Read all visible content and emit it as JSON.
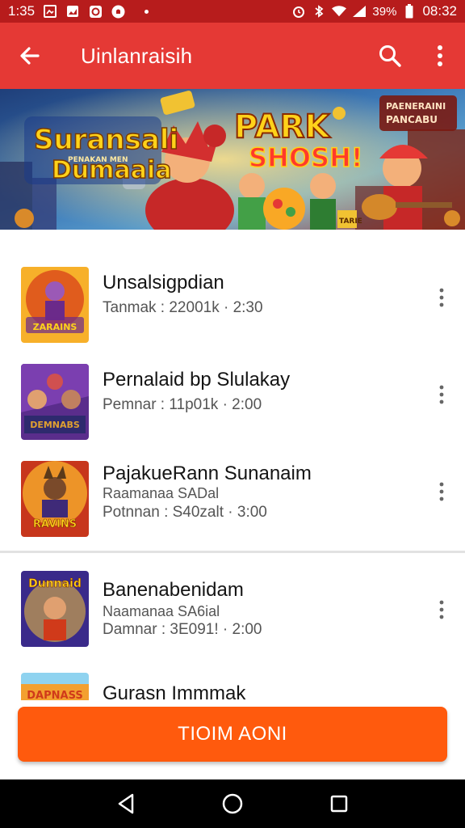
{
  "status_bar": {
    "time": "1:35",
    "battery": "39%",
    "clock": "08:32",
    "icons": [
      "gallery-icon",
      "image-icon",
      "camera-icon",
      "notification-icon",
      "alarm-icon",
      "bluetooth-icon",
      "wifi-icon",
      "signal-icon"
    ]
  },
  "app_bar": {
    "title": "Uinlanraisih",
    "icons": [
      "back-arrow-icon",
      "search-icon",
      "more-vert-icon"
    ]
  },
  "banner": {
    "title_line1": "Suransali",
    "title_sub": "PENAKAN MEN",
    "title_line2": "Dumaaia",
    "park_text": "PARK",
    "shosh_text": "SHOSH!",
    "corner_line1": "PAENERAINI",
    "corner_line2": "PANCABU",
    "badge_text": "TARIE"
  },
  "list": {
    "items": [
      {
        "title": "Unsalsigpdian",
        "line1": "",
        "line2": "Tanmak : 22001k · 2:30",
        "thumb_label": "ZARAINS",
        "colors": [
          "#f7b02a",
          "#d9471a",
          "#6b2a8a"
        ]
      },
      {
        "title": "Pernalaid bp Slulakay",
        "line1": "",
        "line2": "Pemnar : 11p01k · 2:00",
        "thumb_label": "DEMNABS",
        "colors": [
          "#5a2d8c",
          "#2e2a6e",
          "#e0a030"
        ]
      },
      {
        "title": "PajakueRann Sunanaim",
        "line1": "Raamanaa SADal",
        "line2": "Potnnan : S40zalt · 3:00",
        "thumb_label": "RAVINS",
        "colors": [
          "#f3a52a",
          "#c7361c",
          "#3f2a78"
        ]
      },
      {
        "title": "Banenabenidam",
        "line1": "Naamanaa SA6ial",
        "line2": "Damnar : 3E091! · 2:00",
        "thumb_label": "Dunnaid",
        "colors": [
          "#f2c23a",
          "#3a2a8a",
          "#d03a1a"
        ]
      },
      {
        "title": "Gurasn Immmak",
        "line1": "",
        "line2": "",
        "thumb_label": "DAPNASS",
        "colors": [
          "#8fd3f0",
          "#f3a030",
          "#d03a1a"
        ]
      }
    ]
  },
  "cta": {
    "label": "TIOIM AONI"
  },
  "nav_bar": {
    "icons": [
      "back-triangle-icon",
      "home-circle-icon",
      "recents-square-icon"
    ]
  }
}
